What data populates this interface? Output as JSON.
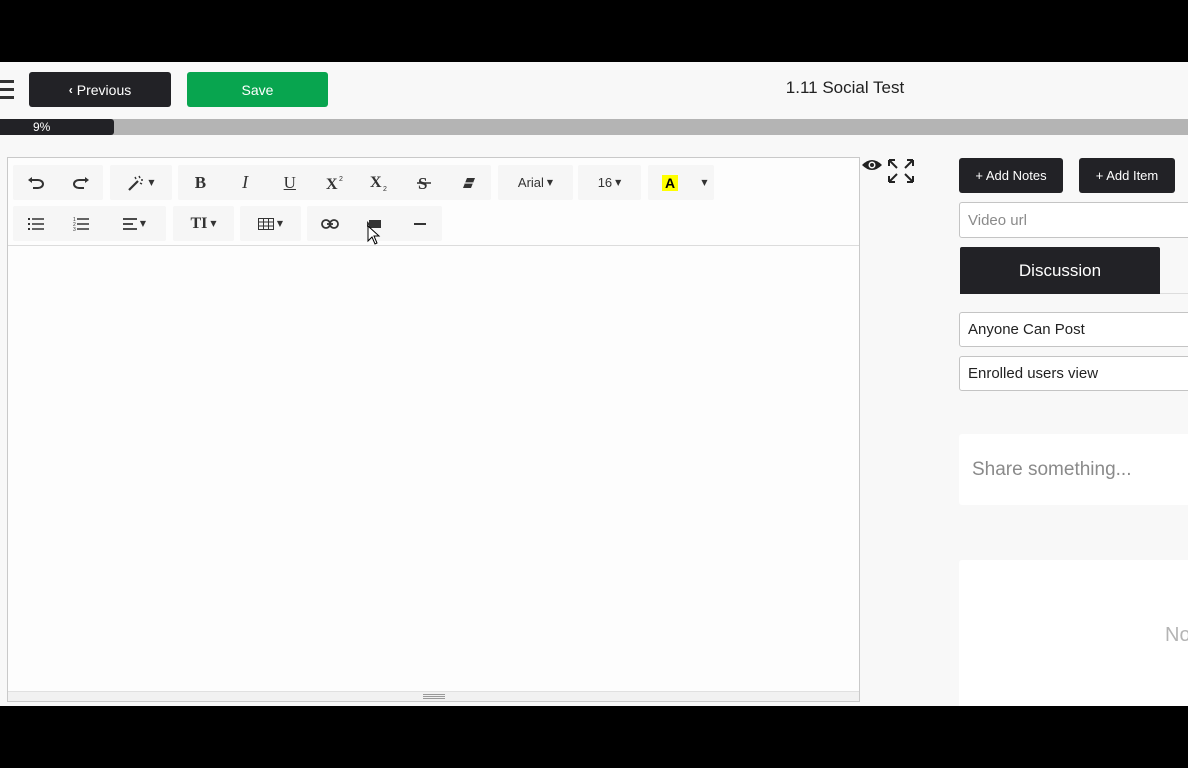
{
  "header": {
    "previous_label": "Previous",
    "save_label": "Save",
    "title": "1.11 Social Test"
  },
  "progress": {
    "label": "9%",
    "value_fraction": 0.096,
    "fill_color": "#222226",
    "track_color": "#b4b4b4"
  },
  "editor": {
    "toolbar_row1": [
      "undo-icon",
      "redo-icon",
      "magic-wand-icon",
      "bold-icon",
      "italic-icon",
      "underline-icon",
      "superscript-icon",
      "subscript-icon",
      "strikethrough-icon",
      "eraser-icon",
      "font-family-select",
      "font-size-select",
      "highlight-color-icon",
      "color-dropdown-icon"
    ],
    "toolbar_row2": [
      "unordered-list-icon",
      "ordered-list-icon",
      "align-icon",
      "text-height-icon",
      "table-icon",
      "link-icon",
      "video-icon",
      "horizontal-rule-icon"
    ],
    "font_family": "Arial",
    "font_size": "16",
    "highlight_letter": "A",
    "bold_letter": "B",
    "italic_letter": "I",
    "underline_letter": "U",
    "text_height_label": "TI"
  },
  "sidebar": {
    "add_notes_label": "+ Add Notes",
    "add_item_label": "+ Add Item",
    "video_url_placeholder": "Video url",
    "discussion_tab": "Discussion",
    "post_permission": "Anyone Can Post",
    "view_permission": "Enrolled users view",
    "share_placeholder": "Share something...",
    "posts_text_partial": "No"
  },
  "colors": {
    "dark_button": "#222226",
    "save_button": "#08a54f",
    "background": "#f8f8f8"
  }
}
